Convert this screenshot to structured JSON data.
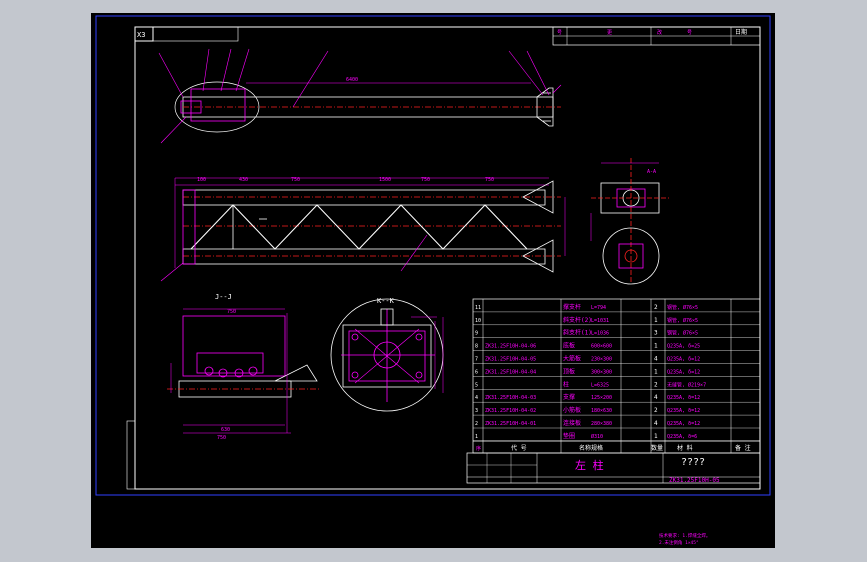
{
  "frame": {
    "corner_label": "X3",
    "title_row_cells": [
      "号",
      "更",
      "改",
      "号",
      "日期"
    ]
  },
  "views": {
    "section_jj": "J--J",
    "section_kk": "K--K",
    "section_aa": "A-A"
  },
  "parts_table": {
    "rows": [
      {
        "no": "11",
        "code": "",
        "name": "撑支杆",
        "dim": "L=794",
        "qty": "2",
        "material": "钢管, Ø76×5"
      },
      {
        "no": "10",
        "code": "",
        "name": "斜支杆(2)",
        "dim": "L=1031",
        "qty": "1",
        "material": "钢管, Ø76×5"
      },
      {
        "no": "9",
        "code": "",
        "name": "斜支杆(1)",
        "dim": "L=1036",
        "qty": "3",
        "material": "钢管, Ø76×5"
      },
      {
        "no": "8",
        "code": "ZK31.25F10H-04-06",
        "name": "底板",
        "dim": "600×600",
        "qty": "1",
        "material": "Q235A, δ=25"
      },
      {
        "no": "7",
        "code": "ZK31.25F10H-04-05",
        "name": "大筋板",
        "dim": "230×300",
        "qty": "4",
        "material": "Q235A, δ=12"
      },
      {
        "no": "6",
        "code": "ZK31.25F10H-04-04",
        "name": "顶板",
        "dim": "300×300",
        "qty": "1",
        "material": "Q235A, δ=12"
      },
      {
        "no": "5",
        "code": "",
        "name": "柱",
        "dim": "L=6325",
        "qty": "2",
        "material": "无缝管, Ø219×7"
      },
      {
        "no": "4",
        "code": "ZK31.25F10H-04-03",
        "name": "支撑",
        "dim": "125×200",
        "qty": "4",
        "material": "Q235A, δ=12"
      },
      {
        "no": "3",
        "code": "ZK31.25F10H-04-02",
        "name": "小筋板",
        "dim": "180×630",
        "qty": "2",
        "material": "Q235A, δ=12"
      },
      {
        "no": "2",
        "code": "ZK31.25F10H-04-01",
        "name": "连接板",
        "dim": "280×380",
        "qty": "4",
        "material": "Q235A, δ=12"
      },
      {
        "no": "1",
        "code": "",
        "name": "垫圈",
        "dim": "Ø310",
        "qty": "1",
        "material": "Q235A, δ=6"
      }
    ],
    "header": {
      "no": "序",
      "code": "代  号",
      "name": "名称规格",
      "qty": "数量",
      "material": "材    料",
      "remark": "备 注"
    }
  },
  "title_block": {
    "title": "左 柱",
    "company": "????",
    "drawing_no": "ZK31.25F10H-05"
  },
  "notes": {
    "line1": "技术要求: 1.焊缝全焊。",
    "line2": "2.未注倒角 1×45°"
  },
  "colors": {
    "frame": "#ffffff",
    "lines": "#ff00ff",
    "axis": "#ff2020",
    "page_bg": "#c3c7ce"
  }
}
